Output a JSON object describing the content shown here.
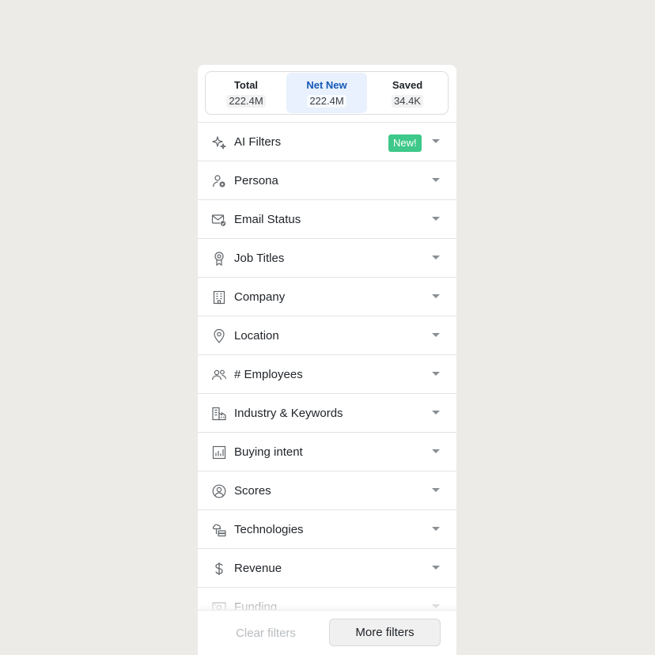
{
  "tabs": [
    {
      "label": "Total",
      "count": "222.4M"
    },
    {
      "label": "Net New",
      "count": "222.4M",
      "active": true
    },
    {
      "label": "Saved",
      "count": "34.4K"
    }
  ],
  "filters": [
    {
      "label": "AI Filters",
      "icon": "sparkle-icon",
      "badge": "New!"
    },
    {
      "label": "Persona",
      "icon": "persona-icon"
    },
    {
      "label": "Email Status",
      "icon": "email-check-icon"
    },
    {
      "label": "Job Titles",
      "icon": "badge-ribbon-icon"
    },
    {
      "label": "Company",
      "icon": "building-icon"
    },
    {
      "label": "Location",
      "icon": "location-pin-icon"
    },
    {
      "label": "# Employees",
      "icon": "people-icon"
    },
    {
      "label": "Industry & Keywords",
      "icon": "industry-icon"
    },
    {
      "label": "Buying intent",
      "icon": "bar-chart-icon"
    },
    {
      "label": "Scores",
      "icon": "user-circle-icon"
    },
    {
      "label": "Technologies",
      "icon": "cloud-stack-icon"
    },
    {
      "label": "Revenue",
      "icon": "dollar-icon"
    },
    {
      "label": "Funding",
      "icon": "funding-icon"
    }
  ],
  "footer": {
    "clear_label": "Clear filters",
    "more_label": "More filters"
  },
  "colors": {
    "accent": "#1659b8",
    "active_tab_bg": "#e8f1fd",
    "badge_bg": "#3ec889"
  }
}
